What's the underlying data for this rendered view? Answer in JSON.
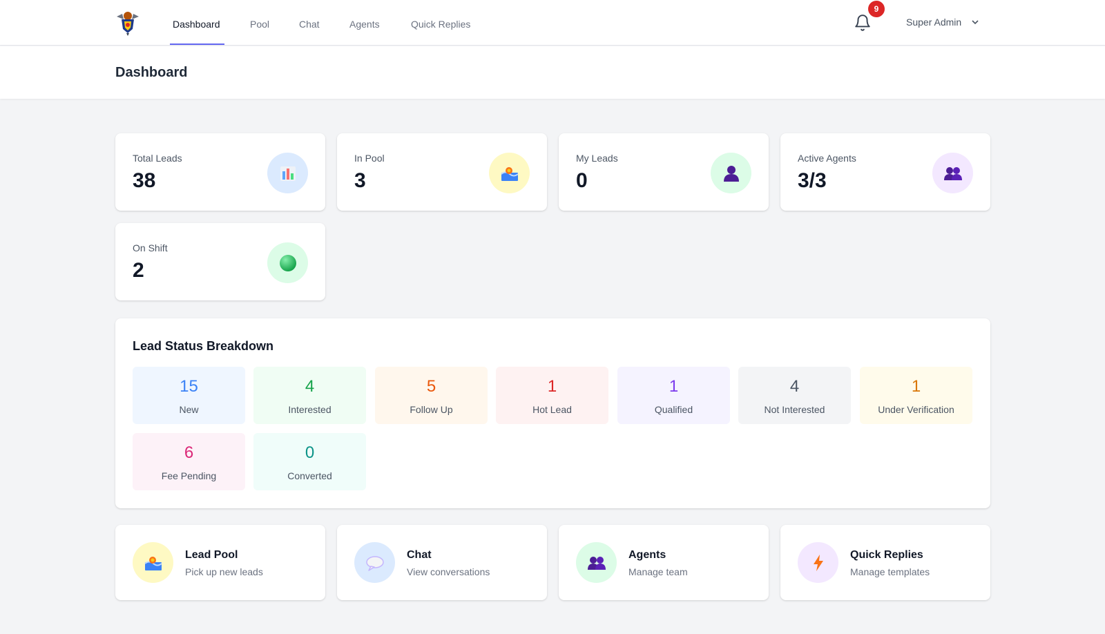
{
  "nav": {
    "items": [
      {
        "label": "Dashboard",
        "active": true
      },
      {
        "label": "Pool"
      },
      {
        "label": "Chat"
      },
      {
        "label": "Agents"
      },
      {
        "label": "Quick Replies"
      }
    ],
    "notification_count": "9",
    "user": "Super Admin",
    "accent_color": "#6366f1"
  },
  "page": {
    "title": "Dashboard"
  },
  "stats": [
    {
      "label": "Total Leads",
      "value": "38",
      "icon": "bar-chart-icon",
      "icon_bg": "#dbeafe"
    },
    {
      "label": "In Pool",
      "value": "3",
      "icon": "wave-pool-icon",
      "icon_bg": "#fef9c3"
    },
    {
      "label": "My Leads",
      "value": "0",
      "icon": "person-icon",
      "icon_bg": "#dcfce7"
    },
    {
      "label": "Active Agents",
      "value": "3/3",
      "icon": "people-icon",
      "icon_bg": "#f3e8ff"
    },
    {
      "label": "On Shift",
      "value": "2",
      "icon": "green-circle-icon",
      "icon_bg": "#dcfce7"
    }
  ],
  "breakdown": {
    "title": "Lead Status Breakdown",
    "items": [
      {
        "value": "15",
        "label": "New",
        "color": "#3b82f6",
        "bg": "#eff6ff"
      },
      {
        "value": "4",
        "label": "Interested",
        "color": "#16a34a",
        "bg": "#f0fdf4"
      },
      {
        "value": "5",
        "label": "Follow Up",
        "color": "#ea580c",
        "bg": "#fff7ed"
      },
      {
        "value": "1",
        "label": "Hot Lead",
        "color": "#dc2626",
        "bg": "#fef2f2"
      },
      {
        "value": "1",
        "label": "Qualified",
        "color": "#7c3aed",
        "bg": "#f5f3ff"
      },
      {
        "value": "4",
        "label": "Not Interested",
        "color": "#4b5563",
        "bg": "#f3f4f6"
      },
      {
        "value": "1",
        "label": "Under Verification",
        "color": "#d97706",
        "bg": "#fffbeb"
      },
      {
        "value": "6",
        "label": "Fee Pending",
        "color": "#db2777",
        "bg": "#fdf2f8"
      },
      {
        "value": "0",
        "label": "Converted",
        "color": "#0d9488",
        "bg": "#f0fdfa"
      }
    ]
  },
  "quick_links": [
    {
      "title": "Lead Pool",
      "subtitle": "Pick up new leads",
      "icon": "wave-pool-icon",
      "icon_bg": "#fef9c3"
    },
    {
      "title": "Chat",
      "subtitle": "View conversations",
      "icon": "speech-bubble-icon",
      "icon_bg": "#dbeafe"
    },
    {
      "title": "Agents",
      "subtitle": "Manage team",
      "icon": "people-icon",
      "icon_bg": "#dcfce7"
    },
    {
      "title": "Quick Replies",
      "subtitle": "Manage templates",
      "icon": "lightning-icon",
      "icon_bg": "#f3e8ff"
    }
  ]
}
